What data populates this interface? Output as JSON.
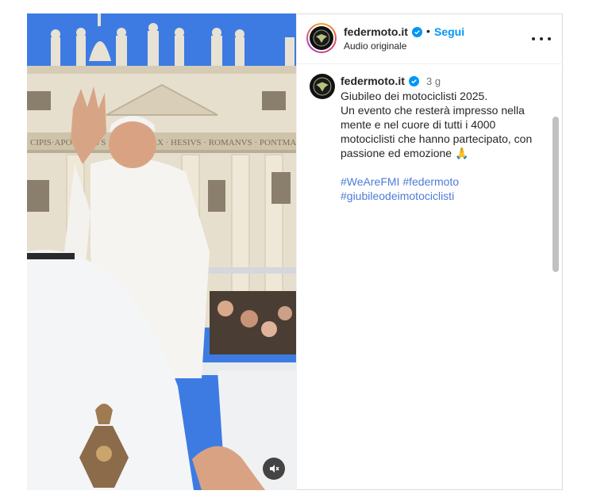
{
  "post": {
    "username": "federmoto.it",
    "follow_label": "Segui",
    "separator": "•",
    "audio_label": "Audio originale",
    "more_icon": "more-horizontal-icon"
  },
  "caption": {
    "username": "federmoto.it",
    "time": "3 g",
    "line1": "Giubileo dei motociclisti 2025.",
    "line2": "Un evento che resterà impresso nella mente e nel cuore di tutti i 4000 motociclisti che hanno partecipato, con passione ed emozione 🙏",
    "hashtag1": "#WeAreFMI",
    "hashtag2": "#federmoto",
    "hashtag3": "#giubileodeimotociclisti"
  },
  "media": {
    "facade_inscription": "CIPIS·APO · AVLVS · PONT · MAX · HESIVS · ROMANVS · PONTMAXAN",
    "mute_icon": "speaker-muted-icon"
  },
  "colors": {
    "accent": "#0095f6",
    "hashtag": "#4d7bd8",
    "verified": "#0095f6",
    "sky": "#3b7ae0"
  }
}
